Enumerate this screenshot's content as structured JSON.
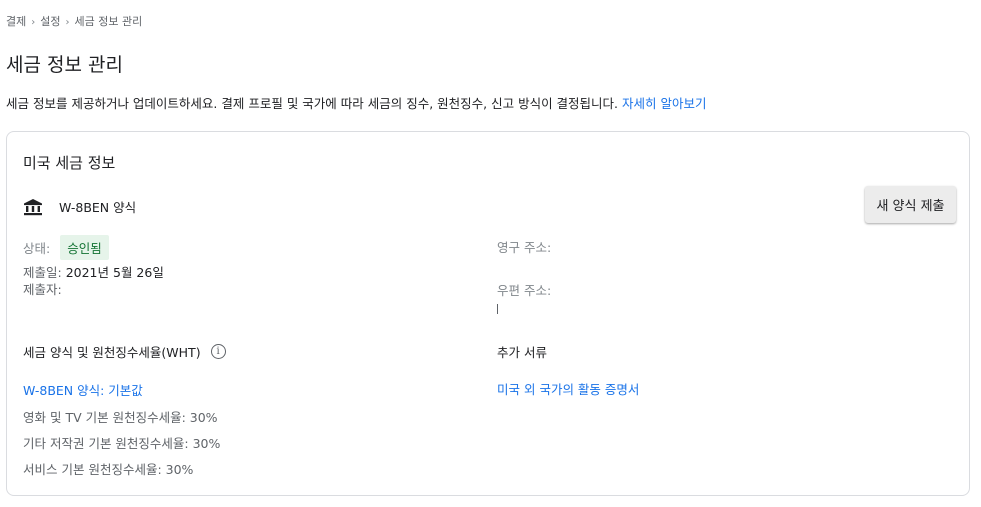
{
  "breadcrumb": {
    "items": [
      "결제",
      "설정",
      "세금 정보 관리"
    ],
    "separator": "›"
  },
  "page": {
    "title": "세금 정보 관리",
    "intro": "세금 정보를 제공하거나 업데이트하세요. 결제 프로필 및 국가에 따라 세금의 징수, 원천징수, 신고 방식이 결정됩니다.",
    "learn_more": "자세히 알아보기"
  },
  "card": {
    "title": "미국 세금 정보",
    "form_icon": "bank-icon",
    "form_name": "W-8BEN 양식",
    "new_form_button": "새 양식 제출",
    "status_label": "상태:",
    "status_value": "승인됨",
    "submit_date_label": "제출일:",
    "submit_date_value": "2021년 5월 26일",
    "submitter_label": "제출자:",
    "permanent_address_label": "영구 주소:",
    "permanent_address_value": "",
    "mailing_address_label": "우편 주소:",
    "mailing_address_value": "",
    "wht_header": "세금 양식 및 원천징수세율(WHT)",
    "info_icon": "info-icon",
    "extra_docs_header": "추가 서류",
    "wht_form_link": "W-8BEN 양식: 기본값",
    "rates": [
      "영화 및 TV 기본 원천징수세율: 30%",
      "기타 저작권 기본 원천징수세율: 30%",
      "서비스 기본 원천징수세율: 30%"
    ],
    "extra_docs_link": "미국 외 국가의 활동 증명서"
  },
  "colors": {
    "link": "#1a73e8",
    "status_bg": "#e6f4ea",
    "status_text": "#137333",
    "border": "#dadce0"
  }
}
